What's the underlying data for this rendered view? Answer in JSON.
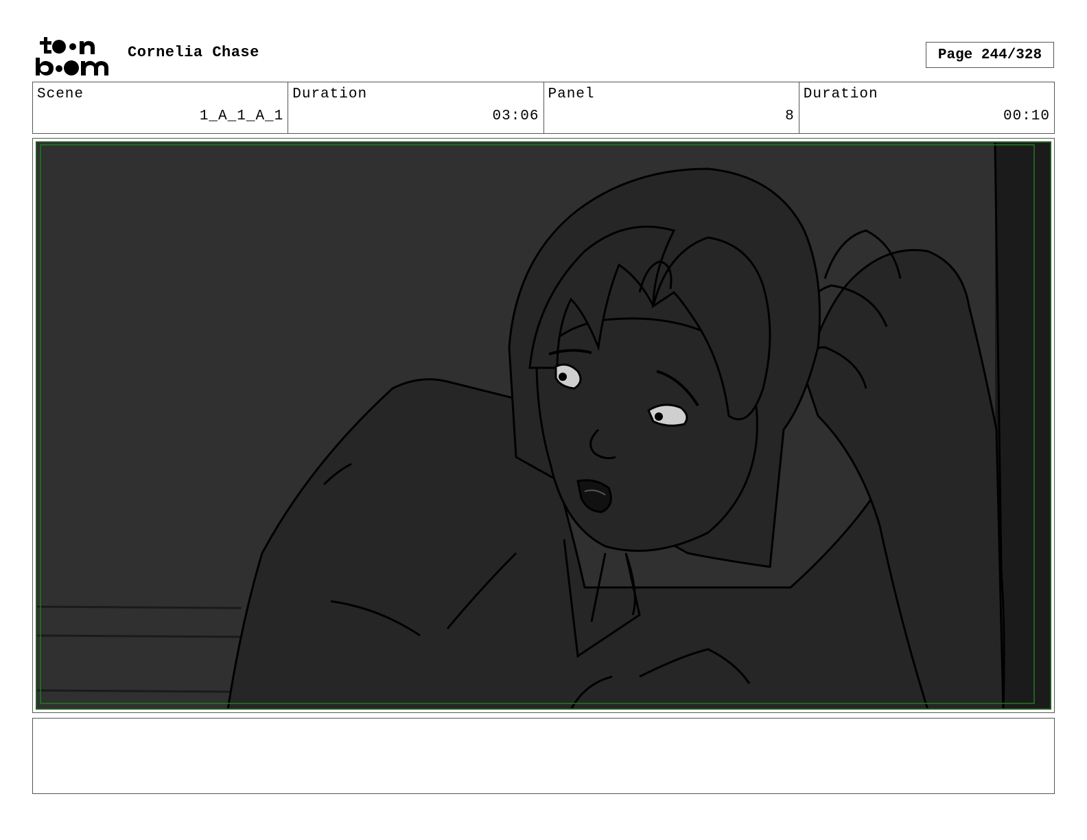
{
  "header": {
    "logo_text": "toon boom",
    "project_title": "Cornelia Chase",
    "page_counter": "Page 244/328"
  },
  "info": {
    "scene_label": "Scene",
    "scene_value": "1_A_1_A_1",
    "scene_duration_label": "Duration",
    "scene_duration_value": "03:06",
    "panel_label": "Panel",
    "panel_value": "8",
    "panel_duration_label": "Duration",
    "panel_duration_value": "00:10"
  },
  "notes": {
    "text": ""
  },
  "colors": {
    "panel_background": "#303030",
    "character_fill": "#262626",
    "safe_frame": "#1f7a1f",
    "line": "#000000"
  }
}
